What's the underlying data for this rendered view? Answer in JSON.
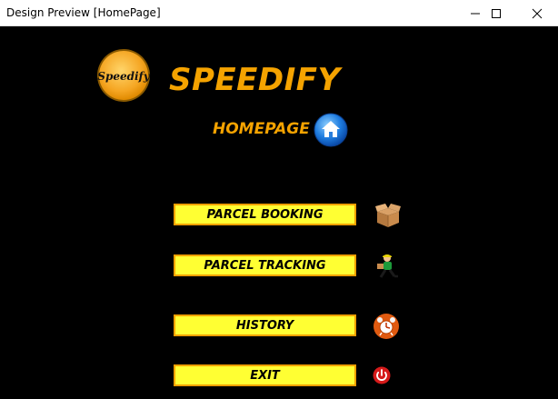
{
  "window": {
    "title": "Design Preview [HomePage]",
    "controls": [
      "minimize-icon",
      "maximize-icon",
      "close-icon"
    ]
  },
  "brand": {
    "logo_text": "Speedify",
    "app_name": "SPEEDIFY",
    "accent_color": "#f5a300"
  },
  "page": {
    "title": "HOMEPAGE",
    "icon": "home-icon"
  },
  "menu": {
    "button_color": "#ffff33",
    "button_border": "#f0a000",
    "items": [
      {
        "label": "PARCEL BOOKING",
        "icon": "parcel-box-icon"
      },
      {
        "label": "PARCEL TRACKING",
        "icon": "delivery-man-icon"
      },
      {
        "label": "HISTORY",
        "icon": "alarm-clock-icon"
      },
      {
        "label": "EXIT",
        "icon": "power-icon"
      }
    ]
  }
}
